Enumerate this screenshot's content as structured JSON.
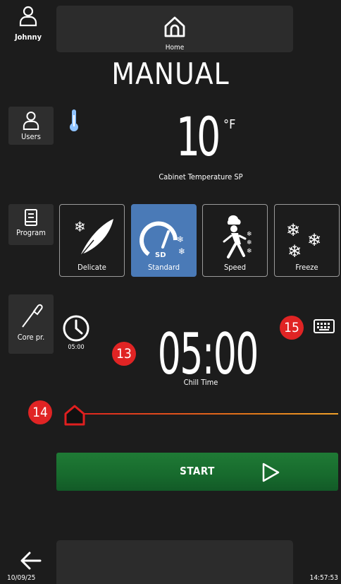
{
  "user": {
    "name": "Johnny",
    "icon": "user-icon"
  },
  "header": {
    "home_label": "Home"
  },
  "title": "MANUAL",
  "sidebar": {
    "users_label": "Users",
    "program_label": "Program",
    "core_label": "Core pr."
  },
  "temperature": {
    "value": "10",
    "unit": "°F",
    "label": "Cabinet Temperature SP"
  },
  "modes": [
    {
      "label": "Delicate",
      "active": false
    },
    {
      "label": "Standard",
      "active": true,
      "badge": "SD"
    },
    {
      "label": "Speed",
      "active": false
    },
    {
      "label": "Freeze",
      "active": false
    }
  ],
  "timer": {
    "value": "05:00",
    "label": "Chill Time",
    "clock_label": "05:00"
  },
  "badges": {
    "b13": "13",
    "b14": "14",
    "b15": "15"
  },
  "start": {
    "label": "START"
  },
  "footer": {
    "date": "10/09/25",
    "time": "14:57:53"
  },
  "colors": {
    "active_mode": "#4a7ab7",
    "start_green": "#1f7a35",
    "badge_red": "#e02424",
    "slider": "#e01f1f"
  }
}
